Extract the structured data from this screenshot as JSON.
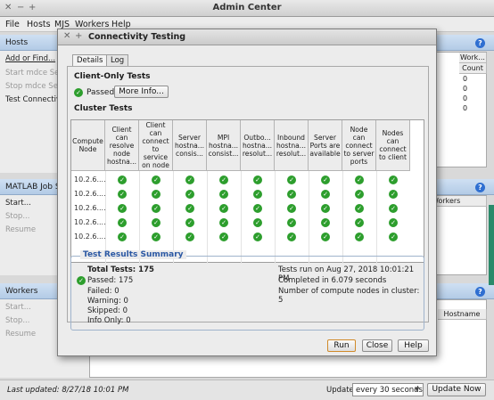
{
  "window": {
    "title": "Admin Center",
    "controls": [
      "✕",
      "−",
      "+"
    ]
  },
  "menu": [
    "File",
    "Hosts",
    "MJS",
    "Workers",
    "Help"
  ],
  "hosts_panel": {
    "title": "Hosts",
    "items": [
      "Add or Find...",
      "Start mdce Ser",
      "Stop mdce Ser",
      "Test Connectiv"
    ],
    "col_workers": "Work...",
    "col_count": "Count",
    "counts": [
      "0",
      "0",
      "0",
      "0"
    ]
  },
  "mjs_panel": {
    "title": "MATLAB Job Sch",
    "items": [
      "Start...",
      "Stop...",
      "Resume"
    ],
    "col_workers": "Workers"
  },
  "workers_panel": {
    "title": "Workers",
    "items": [
      "Start...",
      "Stop...",
      "Resume"
    ],
    "col_hostname": "Hostname"
  },
  "status": {
    "last_updated": "Last updated: 8/27/18 10:01 PM",
    "update_label": "Update",
    "update_interval": "every 30 seconds",
    "update_now": "Update Now"
  },
  "dialog": {
    "title": "Connectivity Testing",
    "controls": [
      "✕",
      "+"
    ],
    "tabs": [
      "Details",
      "Log"
    ],
    "client_title": "Client-Only Tests",
    "client_status": "Passed",
    "more_info": "More Info...",
    "cluster_title": "Cluster Tests",
    "columns": [
      "Compute Node",
      "Client can resolve node hostna...",
      "Client can connect to service on node",
      "Server hostna... consis...",
      "MPI hostna... consist...",
      "Outbo... hostna... resolut...",
      "Inbound hostna... resolut...",
      "Server Ports are available",
      "Node can connect to server ports",
      "Nodes can connect to client"
    ],
    "nodes": [
      "10.2.6....",
      "10.2.6....",
      "10.2.6....",
      "10.2.6....",
      "10.2.6...."
    ],
    "summary": {
      "title": "Test Results Summary",
      "total": "Total Tests: 175",
      "passed": "Passed: 175",
      "failed": "Failed: 0",
      "warning": "Warning: 0",
      "skipped": "Skipped: 0",
      "info": "Info Only: 0",
      "run_at": "Tests run on Aug 27, 2018 10:01:21 PM",
      "completed": "Completed in 6.079 seconds",
      "nodes_count": "Number of compute nodes in cluster: 5"
    },
    "buttons": {
      "run": "Run",
      "close": "Close",
      "help": "Help"
    }
  },
  "colors": {
    "accent": "#2b58a3",
    "pass": "#2d9e2d",
    "panel_header": "#c2d6ee"
  }
}
